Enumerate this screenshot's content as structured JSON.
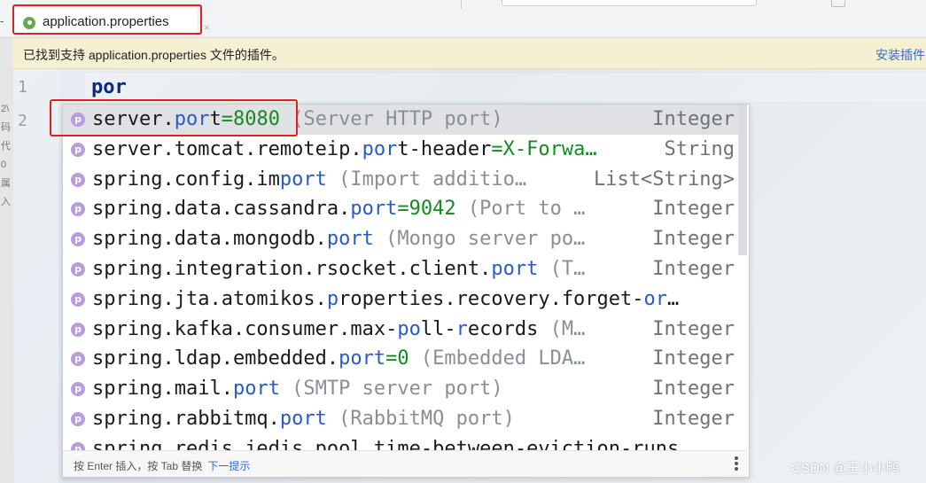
{
  "tab": {
    "label": "application.properties",
    "close": "×"
  },
  "banner": {
    "message": "已找到支持 application.properties 文件的插件。",
    "action": "安装插件"
  },
  "editor": {
    "line_numbers": [
      "1",
      "2"
    ],
    "typed_text": "por"
  },
  "side_chars": "2\\ 码 代 0 属 入",
  "completion": {
    "items": [
      {
        "pre": "server.",
        "m1": "por",
        "mid": "t",
        "m2": "",
        "post": "",
        "value": "=8080",
        "desc": " (Server HTTP port)",
        "type": "Integer"
      },
      {
        "pre": "server.tomcat.remoteip.",
        "m1": "por",
        "mid": "t-header",
        "m2": "",
        "post": "",
        "value": "=X-Forwa…",
        "desc": "",
        "type": "String"
      },
      {
        "pre": "spring.config.im",
        "m1": "port",
        "mid": "",
        "m2": "",
        "post": "",
        "value": "",
        "desc": " (Import additio…",
        "type": "List<String>"
      },
      {
        "pre": "spring.data.cassandra.",
        "m1": "port",
        "mid": "",
        "m2": "",
        "post": "",
        "value": "=9042",
        "desc": " (Port to …",
        "type": "Integer"
      },
      {
        "pre": "spring.data.mongodb.",
        "m1": "port",
        "mid": "",
        "m2": "",
        "post": "",
        "value": "",
        "desc": " (Mongo server po…",
        "type": "Integer"
      },
      {
        "pre": "spring.integration.rsocket.client.",
        "m1": "port",
        "mid": "",
        "m2": "",
        "post": "",
        "value": "",
        "desc": " (T…",
        "type": "Integer"
      },
      {
        "pre": "spring.jta.atomikos.",
        "m1": "p",
        "mid": "roperties.recovery.forget-",
        "m2": "or",
        "post": "…",
        "value": "",
        "desc": "",
        "type": ""
      },
      {
        "pre": "spring.kafka.consumer.max-",
        "m1": "po",
        "mid": "ll-",
        "m2": "r",
        "post": "ecords",
        "value": "",
        "desc": " (M…",
        "type": "Integer"
      },
      {
        "pre": "spring.ldap.embedded.",
        "m1": "port",
        "mid": "",
        "m2": "",
        "post": "",
        "value": "=0",
        "desc": " (Embedded LDA…",
        "type": "Integer"
      },
      {
        "pre": "spring.mail.",
        "m1": "port",
        "mid": "",
        "m2": "",
        "post": "",
        "value": "",
        "desc": " (SMTP server port)",
        "type": "Integer"
      },
      {
        "pre": "spring.rabbitmq.",
        "m1": "port",
        "mid": "",
        "m2": "",
        "post": "",
        "value": "",
        "desc": " (RabbitMQ port)",
        "type": "Integer"
      },
      {
        "pre": "spring.redis.jedis.pool.time-between-eviction-runs",
        "m1": "",
        "mid": "",
        "m2": "",
        "post": "",
        "value": "",
        "desc": "",
        "type": ""
      }
    ],
    "footer_hint": "按 Enter 插入，按 Tab 替换",
    "footer_link": "下一提示"
  },
  "watermark": "CSDN @王小小鸭"
}
